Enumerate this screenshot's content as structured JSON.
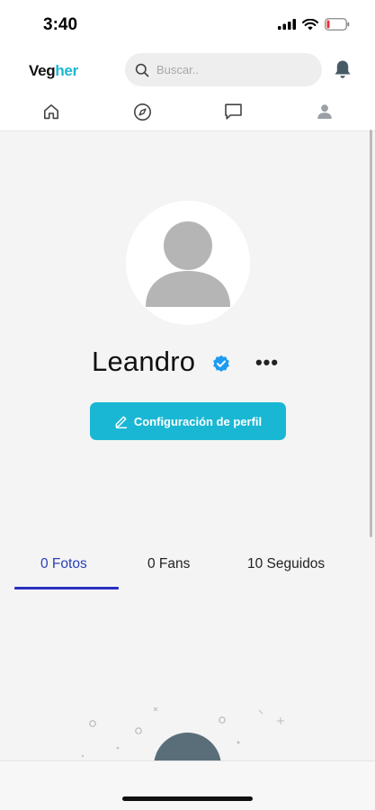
{
  "status_bar": {
    "time": "3:40"
  },
  "header": {
    "logo_prefix": "Veg",
    "logo_accent": "her",
    "search_placeholder": "Buscar..",
    "nav_icons": [
      "home-icon",
      "compass-icon",
      "chat-icon",
      "user-icon"
    ]
  },
  "profile": {
    "name": "Leandro",
    "verified": true,
    "more_label": "•••",
    "edit_label": "Configuración de perfil"
  },
  "tabs": [
    {
      "label": "0 Fotos",
      "active": true
    },
    {
      "label": "0 Fans",
      "active": false
    },
    {
      "label": "10 Seguidos",
      "active": false
    }
  ],
  "colors": {
    "accent": "#1ab7d4",
    "tab_active": "#2a3fb8"
  }
}
